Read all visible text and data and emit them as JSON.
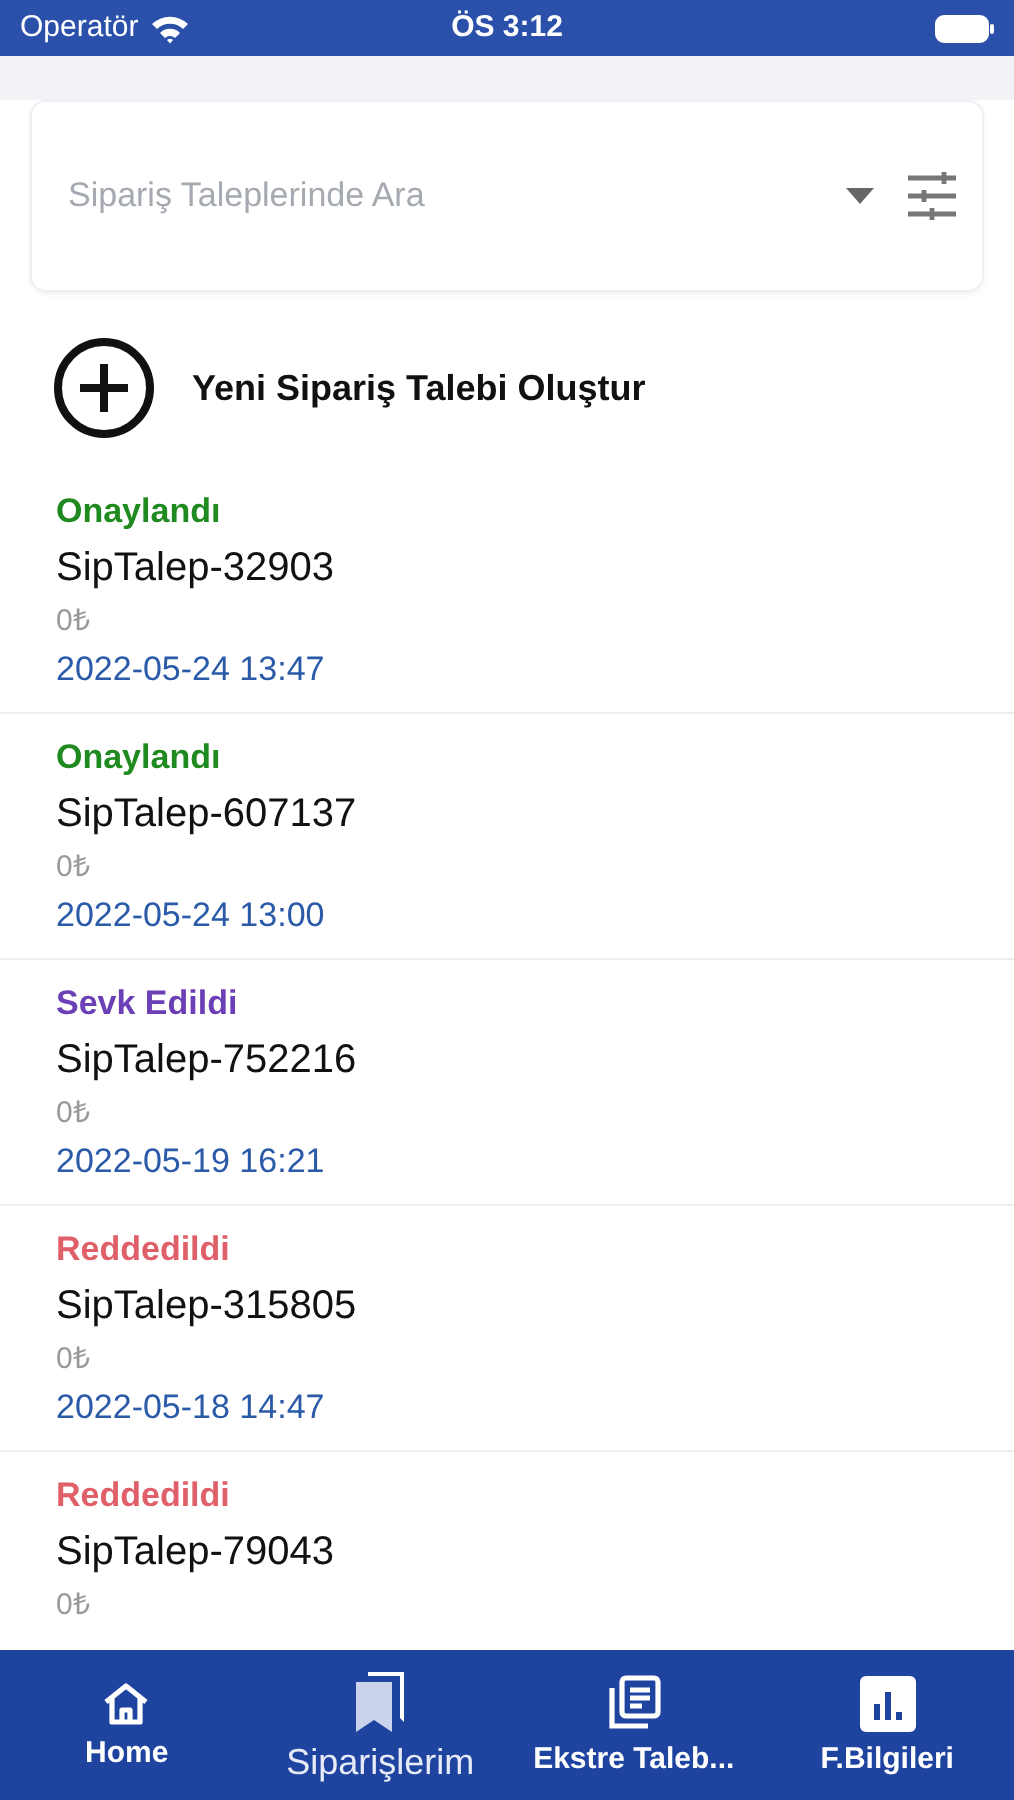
{
  "status_bar": {
    "carrier": "Operatör",
    "time": "ÖS 3:12"
  },
  "search": {
    "placeholder": "Sipariş Taleplerinde Ara"
  },
  "create_button": {
    "label": "Yeni Sipariş Talebi Oluştur"
  },
  "orders": [
    {
      "status": "Onaylandı",
      "color": "#1f8a1f",
      "number": "SipTalep-32903",
      "amount": "0₺",
      "date": "2022-05-24 13:47"
    },
    {
      "status": "Onaylandı",
      "color": "#1f8a1f",
      "number": "SipTalep-607137",
      "amount": "0₺",
      "date": "2022-05-24 13:00"
    },
    {
      "status": "Sevk Edildi",
      "color": "#6b3fb5",
      "number": "SipTalep-752216",
      "amount": "0₺",
      "date": "2022-05-19 16:21"
    },
    {
      "status": "Reddedildi",
      "color": "#e0606a",
      "number": "SipTalep-315805",
      "amount": "0₺",
      "date": "2022-05-18 14:47"
    },
    {
      "status": "Reddedildi",
      "color": "#e0606a",
      "number": "SipTalep-79043",
      "amount": "0₺"
    }
  ],
  "tabs": [
    {
      "kind": "home",
      "label": "Home",
      "selected": false
    },
    {
      "kind": "bookmarks",
      "label": "Siparişlerim",
      "selected": true
    },
    {
      "kind": "list",
      "label": "Ekstre Taleb...",
      "selected": false
    },
    {
      "kind": "chart",
      "label": "F.Bilgileri",
      "selected": false
    }
  ]
}
